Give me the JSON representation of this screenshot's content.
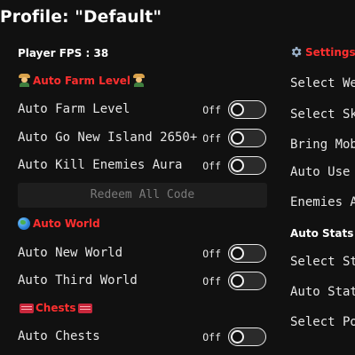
{
  "profile": {
    "title": "Profile: \"Default\""
  },
  "left": {
    "fps_label": "Player FPS : 38",
    "auto_farm_header": "Auto Farm Level",
    "auto_farm_rows": [
      {
        "label": "Auto Farm Level",
        "state": "Off"
      },
      {
        "label": "Auto Go New Island 2650+",
        "state": "Off"
      },
      {
        "label": "Auto Kill Enemies Aura",
        "state": "Off"
      }
    ],
    "redeem_button": "Redeem All Code",
    "auto_world_header": "Auto World",
    "auto_world_rows": [
      {
        "label": "Auto New World",
        "state": "Off"
      },
      {
        "label": "Auto Third World",
        "state": "Off"
      }
    ],
    "chests_header": "Chests",
    "chests_rows": [
      {
        "label": "Auto Chests",
        "state": "Off"
      }
    ]
  },
  "right": {
    "settings_header": "Settings",
    "items_top": [
      "Select We",
      "Select Sk",
      "Bring Mob",
      "Auto Use",
      "Enemies A"
    ],
    "auto_stats_header": "Auto Stats",
    "items_bottom": [
      "Select St",
      "Auto Stat",
      "Select Po"
    ]
  },
  "colors": {
    "background": "#111111",
    "header_red": "#ff2f2f",
    "text": "#e6e6e6",
    "button_bg": "#1e1e1e",
    "button_text": "#7a7a7a"
  },
  "icons": {
    "auto_farm": "farmer-icon",
    "auto_world": "globe-icon",
    "chests": "chest-icon",
    "settings": "gear-icon"
  }
}
